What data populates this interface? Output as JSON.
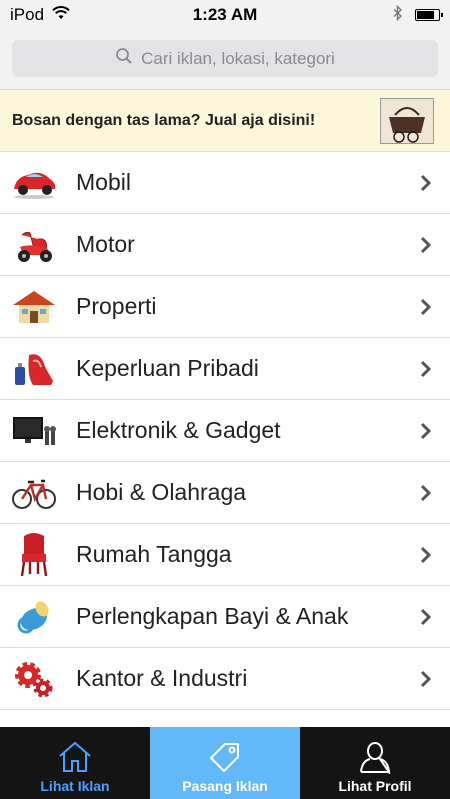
{
  "status_bar": {
    "carrier": "iPod",
    "time": "1:23 AM",
    "battery_level": 0.85
  },
  "search": {
    "placeholder": "Cari iklan, lokasi, kategori",
    "icon": "search-icon"
  },
  "banner": {
    "text": "Bosan dengan tas lama? Jual aja disini!",
    "image": "handbag-thumbnail"
  },
  "categories": [
    {
      "label": "Mobil",
      "icon": "car-icon"
    },
    {
      "label": "Motor",
      "icon": "scooter-icon"
    },
    {
      "label": "Properti",
      "icon": "house-icon"
    },
    {
      "label": "Keperluan Pribadi",
      "icon": "shoes-perfume-icon"
    },
    {
      "label": "Elektronik & Gadget",
      "icon": "tv-icon"
    },
    {
      "label": "Hobi & Olahraga",
      "icon": "bicycle-icon"
    },
    {
      "label": "Rumah Tangga",
      "icon": "chair-icon"
    },
    {
      "label": "Perlengkapan Bayi & Anak",
      "icon": "pacifier-icon"
    },
    {
      "label": "Kantor & Industri",
      "icon": "gears-icon"
    }
  ],
  "tabs": [
    {
      "label": "Lihat Iklan",
      "icon": "home-icon",
      "active": true
    },
    {
      "label": "Pasang Iklan",
      "icon": "tag-icon",
      "highlighted": true
    },
    {
      "label": "Lihat Profil",
      "icon": "person-icon"
    }
  ],
  "colors": {
    "tab_bar_bg": "#141414",
    "tab_active_text": "#4aa0ff",
    "tab_highlight_bg": "#63b8f7",
    "banner_bg": "#fcf6da"
  }
}
